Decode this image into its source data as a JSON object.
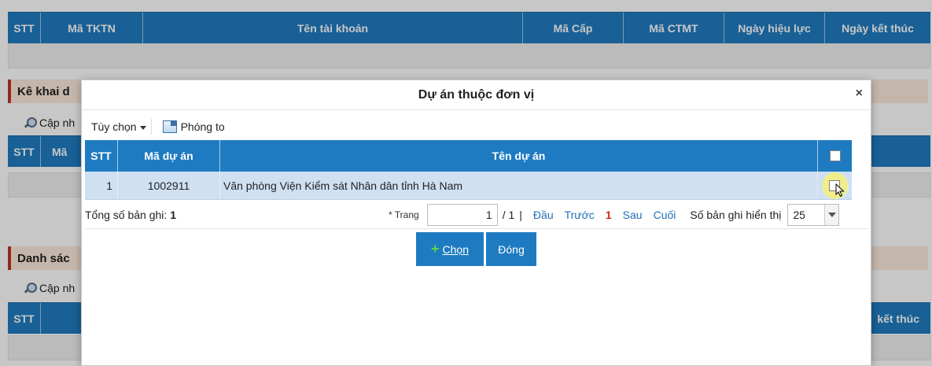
{
  "background": {
    "top_table_headers": [
      "STT",
      "Mã TKTN",
      "Tên tài khoản",
      "Mã Cấp",
      "Mã CTMT",
      "Ngày hiệu lực",
      "Ngày kết thúc"
    ],
    "section1_title": "Kê khai d",
    "section1_toolbar_label": "Cập nh",
    "section1_headers": [
      "STT",
      "Mã"
    ],
    "section2_title": "Danh sác",
    "section2_toolbar_label": "Cập nh",
    "section2_headers": [
      "STT"
    ],
    "section2_right_header": "kết thúc"
  },
  "dialog": {
    "title": "Dự án thuộc đơn vị",
    "close_label": "×",
    "toolbar": {
      "options_label": "Tùy chọn",
      "zoom_label": "Phóng to"
    },
    "grid": {
      "headers": [
        "STT",
        "Mã dự án",
        "Tên dự án"
      ],
      "rows": [
        {
          "stt": "1",
          "code": "1002911",
          "name": "Văn phòng Viện Kiểm sát Nhân dân tỉnh Hà Nam"
        }
      ]
    },
    "pager": {
      "total_label": "Tổng số bản ghi:",
      "total_value": "1",
      "page_label": "* Trang",
      "page_value": "1",
      "page_of": "/ 1",
      "separator": "|",
      "first": "Đầu",
      "prev": "Trước",
      "current": "1",
      "next": "Sau",
      "last": "Cuối",
      "per_page_label": "Số bản ghi hiển thị",
      "per_page_value": "25"
    },
    "buttons": {
      "choose_prefix": "",
      "choose": "Chọn",
      "close": "Đóng"
    }
  },
  "colors": {
    "header_blue": "#1f7bc1",
    "selected_row": "#cfe0f3",
    "section_red": "#c0322b",
    "current_page_red": "#d0271d"
  }
}
